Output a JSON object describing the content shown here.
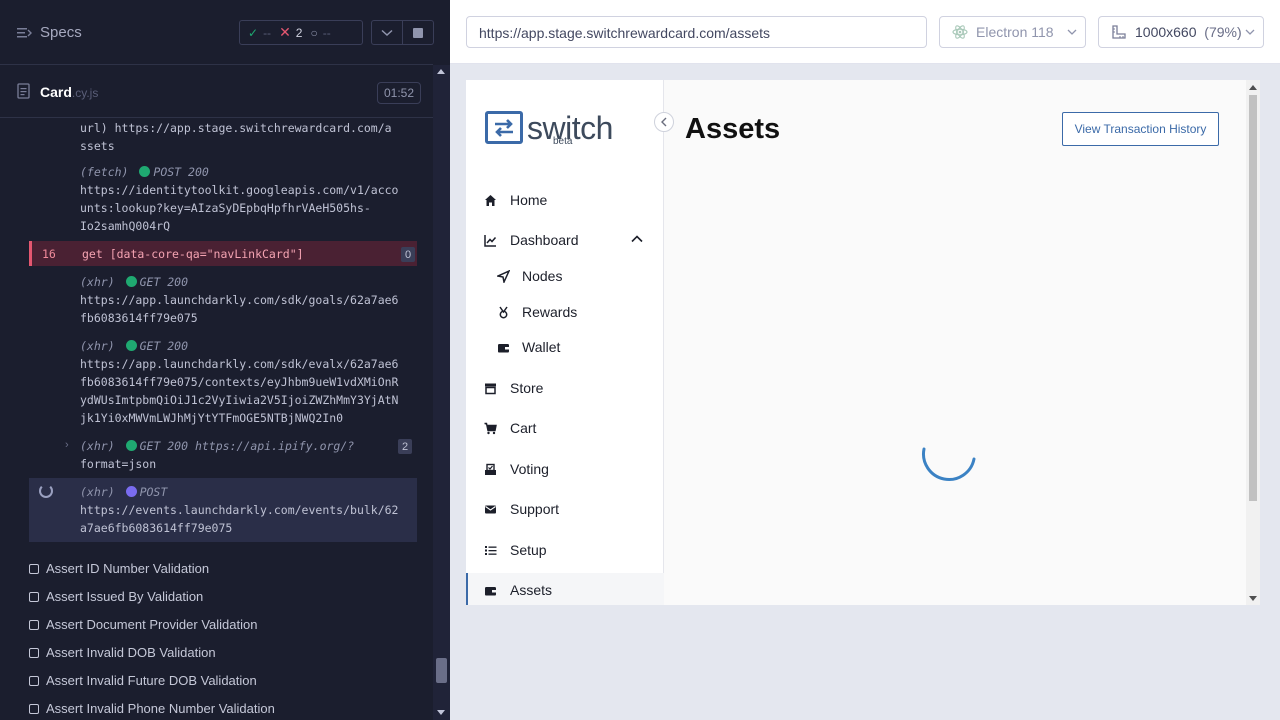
{
  "reporter": {
    "header": {
      "title": "Specs",
      "passed": "--",
      "failed": "2",
      "pending": "--",
      "icons": {
        "menu": "list-icon",
        "pass": "check-icon",
        "fail": "x-icon",
        "pending": "circle-notch-icon",
        "expand": "chevron-down-icon",
        "stop": "stop-icon"
      }
    },
    "spec": {
      "name": "Card",
      "ext": ".cy.js",
      "duration": "01:52",
      "icon": "file-icon"
    },
    "log": {
      "entry1": {
        "line1": "url)  https://app.stage.switchrewardcard.com/a",
        "line2": "ssets"
      },
      "entry2": {
        "kind": "(fetch)",
        "status": "POST 200",
        "line2": "https://identitytoolkit.googleapis.com/v1/acco",
        "line3": "unts:lookup?key=AIzaSyDEpbqHpfhrVAeH505hs-",
        "line4": "Io2samhQ004rQ"
      },
      "failed_command": {
        "number": "16",
        "text": "get  [data-core-qa=\"navLinkCard\"]",
        "badge": "0"
      },
      "entry3": {
        "kind": "(xhr)",
        "status": "GET 200",
        "line2": "https://app.launchdarkly.com/sdk/goals/62a7ae6",
        "line3": "fb6083614ff79e075"
      },
      "entry4": {
        "kind": "(xhr)",
        "status": "GET 200",
        "line2": "https://app.launchdarkly.com/sdk/evalx/62a7ae6",
        "line3": "fb6083614ff79e075/contexts/eyJhbm9ueW1vdXMiOnR",
        "line4": "ydWUsImtpbmQiOiJ1c2VyIiwia2V5IjoiZWZhMmY3YjAtN",
        "line5": "jk1Yi0xMWVmLWJhMjYtYTFmOGE5NTBjNWQ2In0"
      },
      "entry5": {
        "kind": "(xhr)",
        "status": "GET 200 https://api.ipify.org/?",
        "line2": "format=json",
        "badge": "2"
      },
      "entry6": {
        "kind": "(xhr)",
        "status": "POST",
        "line2": "https://events.launchdarkly.com/events/bulk/62",
        "line3": "a7ae6fb6083614ff79e075"
      }
    },
    "tests": [
      "Assert ID Number Validation",
      "Assert Issued By Validation",
      "Assert Document Provider Validation",
      "Assert Invalid DOB Validation",
      "Assert Invalid Future DOB Validation",
      "Assert Invalid Phone Number Validation"
    ]
  },
  "toolbar": {
    "url": "https://app.stage.switchrewardcard.com/assets",
    "browser": "Electron 118",
    "viewport": "1000x660",
    "scale": "(79%)",
    "icons": {
      "browser": "electron-icon",
      "viewport": "ruler-icon",
      "caret": "chevron-down-icon"
    }
  },
  "app": {
    "logo": {
      "word": "switch",
      "tag": "beta"
    },
    "nav": {
      "home": "Home",
      "dashboard": "Dashboard",
      "nodes": "Nodes",
      "rewards": "Rewards",
      "wallet": "Wallet",
      "store": "Store",
      "cart": "Cart",
      "voting": "Voting",
      "support": "Support",
      "setup": "Setup",
      "assets": "Assets"
    },
    "page_title": "Assets",
    "txn_button": "View Transaction History"
  },
  "colors": {
    "reporter_bg": "#1b1e2e",
    "fail": "#e45770",
    "pass": "#1fa971",
    "brand": "#3b6aa8"
  }
}
